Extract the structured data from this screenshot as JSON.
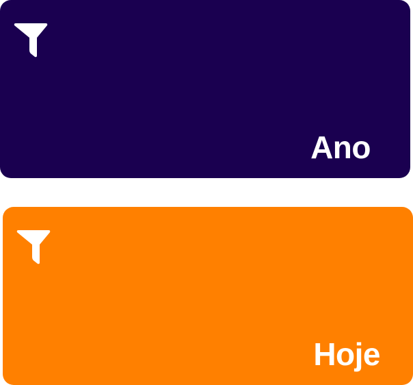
{
  "cards": [
    {
      "label": "Ano",
      "icon": "filter-icon",
      "color": "#1a0050"
    },
    {
      "label": "Hoje",
      "icon": "filter-icon",
      "color": "#ff8000"
    }
  ]
}
